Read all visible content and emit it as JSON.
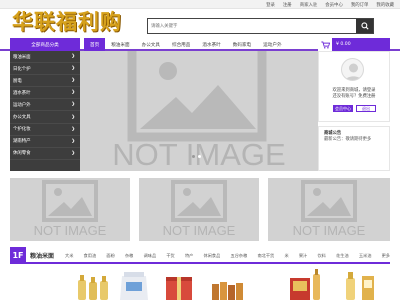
{
  "topbar": {
    "links": [
      "登录",
      "注册",
      "商家入驻",
      "会员中心",
      "我的订单",
      "我的收藏"
    ]
  },
  "logo": {
    "text": "华联福利购"
  },
  "search": {
    "placeholder": "请输入关键字"
  },
  "categories": {
    "label": "全部商品分类",
    "items": [
      "粮油米面",
      "日化个护",
      "厨电",
      "酒水茶叶",
      "运动户外",
      "办公文具",
      "个护化妆",
      "湖南特产",
      "休闲零食"
    ]
  },
  "nav": {
    "tabs": [
      "首页",
      "粮油米面",
      "办公文具",
      "综合用品",
      "酒水茶叶",
      "数码家电",
      "运动户外"
    ],
    "active_index": 0
  },
  "cart": {
    "amount": "¥ 0.00"
  },
  "banner": {
    "text": "NOT IMAGE"
  },
  "placeholders": {
    "text": "NOT IMAGE"
  },
  "user": {
    "welcome_line1": "欢迎来到商城，请登录",
    "welcome_line2": "还没有账号？免费注册",
    "btn_member": "会员中心",
    "btn_logout": "退出"
  },
  "notice": {
    "title": "商城公告",
    "item": "最新公告：敬请期待更多"
  },
  "floor": {
    "number": "1F",
    "title": "粮油米面",
    "tags": [
      "大米",
      "食用油",
      "面粉",
      "杂粮",
      "调味品",
      "干货",
      "特产",
      "休闲食品",
      "五谷杂粮",
      "南北干货",
      "米",
      "果汁",
      "饮料",
      "花生油",
      "玉米油",
      "更多"
    ]
  },
  "colors": {
    "accent": "#6e2bd9",
    "sidebar_bg": "#3d3d3d",
    "logo": "#d6a11c",
    "placeholder_bg": "#d2d2d2"
  }
}
